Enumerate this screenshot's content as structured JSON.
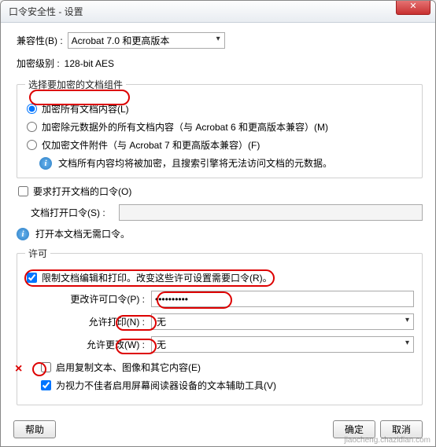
{
  "window": {
    "title": "口令安全性 - 设置",
    "close": "✕"
  },
  "compat": {
    "label": "兼容性(B) :",
    "value": "Acrobat 7.0 和更高版本"
  },
  "encrypt_level": {
    "label": "加密级别 :",
    "value": "128-bit AES"
  },
  "group1": {
    "legend": "选择要加密的文档组件",
    "opt1": "加密所有文档内容(L)",
    "opt2": "加密除元数据外的所有文档内容（与 Acrobat 6 和更高版本兼容）(M)",
    "opt3": "仅加密文件附件（与 Acrobat 7 和更高版本兼容）(F)",
    "info": "文档所有内容均将被加密，且搜索引擎将无法访问文档的元数据。"
  },
  "open_pw": {
    "check": "要求打开文档的口令(O)",
    "label": "文档打开口令(S) :",
    "info": "打开本文档无需口令。"
  },
  "perm": {
    "legend": "许可",
    "restrict": "限制文档编辑和打印。改变这些许可设置需要口令(R)。",
    "change_pw_label": "更改许可口令(P) :",
    "change_pw_value": "**********",
    "print_label": "允许打印(N) :",
    "print_value": "无",
    "change_label": "允许更改(W) :",
    "change_value": "无",
    "copy": "启用复制文本、图像和其它内容(E)",
    "reader": "为视力不佳者启用屏幕阅读器设备的文本辅助工具(V)"
  },
  "buttons": {
    "help": "帮助",
    "ok": "确定",
    "cancel": "取消"
  },
  "watermark": "jiaocheng.chazidian.com"
}
